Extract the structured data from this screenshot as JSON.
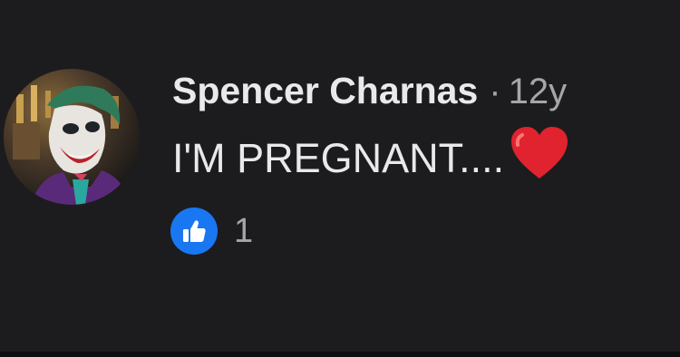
{
  "comment": {
    "author": "Spencer Charnas",
    "separator": "·",
    "time": "12y",
    "text": "I'M PREGNANT....",
    "emoji": "heart-icon",
    "reaction_count": "1",
    "reaction_type": "like-icon"
  },
  "colors": {
    "background": "#1c1c1e",
    "primary_text": "#e9e9eb",
    "secondary_text": "#a6a6aa",
    "like_blue": "#1a77f2",
    "heart_red": "#e0232e"
  }
}
